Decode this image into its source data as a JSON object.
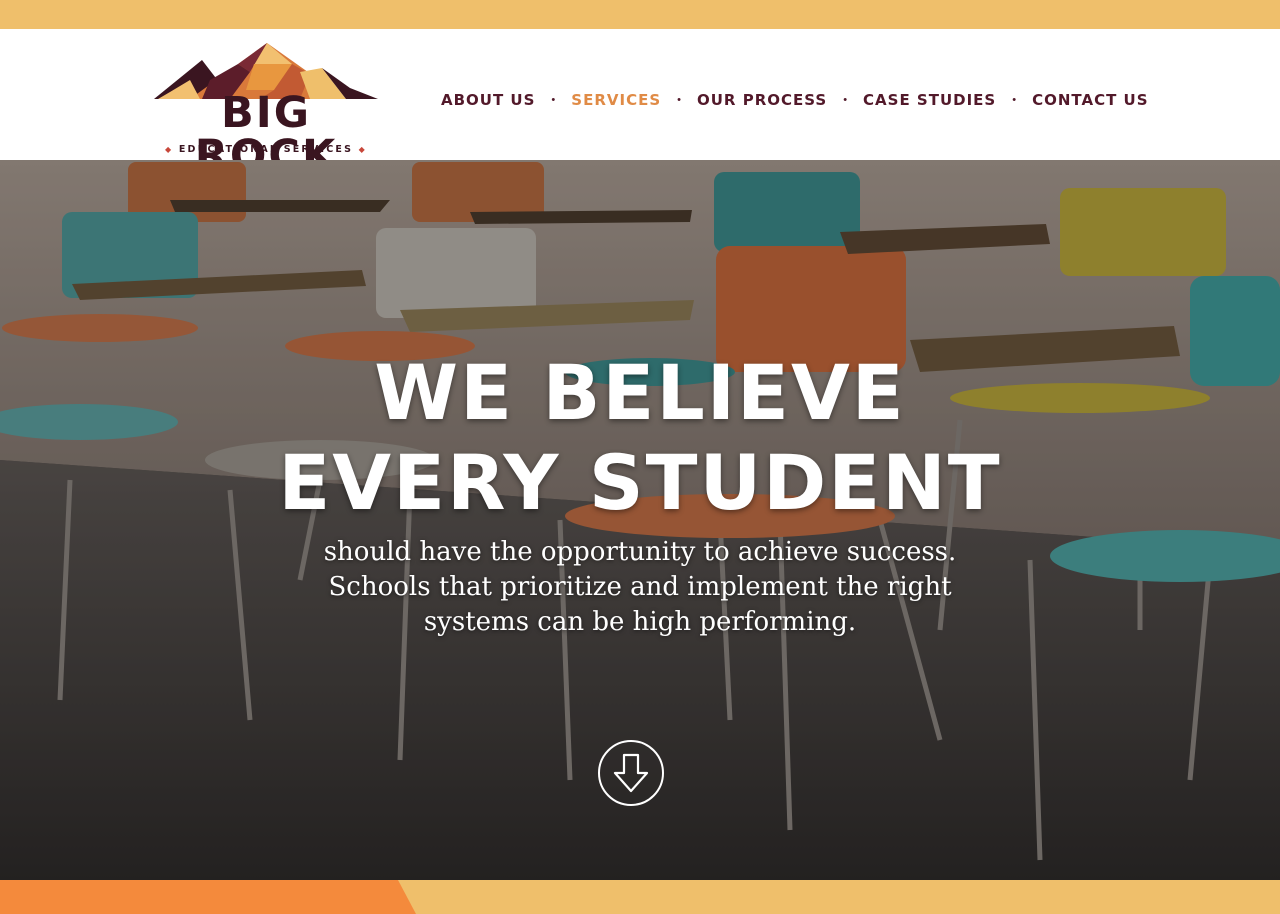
{
  "brand": {
    "name": "BIG ROCK",
    "tagline": "EDUCATIONAL SERVICES",
    "colors": {
      "top_strip": "#efbf6b",
      "accent_orange": "#e08b46",
      "maroon": "#52192a",
      "bottom_accent": "#f48a3c"
    }
  },
  "nav": {
    "items": [
      {
        "label": "ABOUT US",
        "active": false
      },
      {
        "label": "SERVICES",
        "active": true
      },
      {
        "label": "OUR PROCESS",
        "active": false
      },
      {
        "label": "CASE STUDIES",
        "active": false
      },
      {
        "label": "CONTACT US",
        "active": false
      }
    ],
    "separator": "•"
  },
  "hero": {
    "title_line1": "WE BELIEVE",
    "title_line2": "EVERY STUDENT",
    "text_line1": "should have the opportunity to achieve success.",
    "text_line2": "Schools that prioritize and implement the right",
    "text_line3": "systems can be high performing.",
    "image": "classroom-chairs-photo",
    "scroll_icon": "arrow-down-circle-icon"
  }
}
